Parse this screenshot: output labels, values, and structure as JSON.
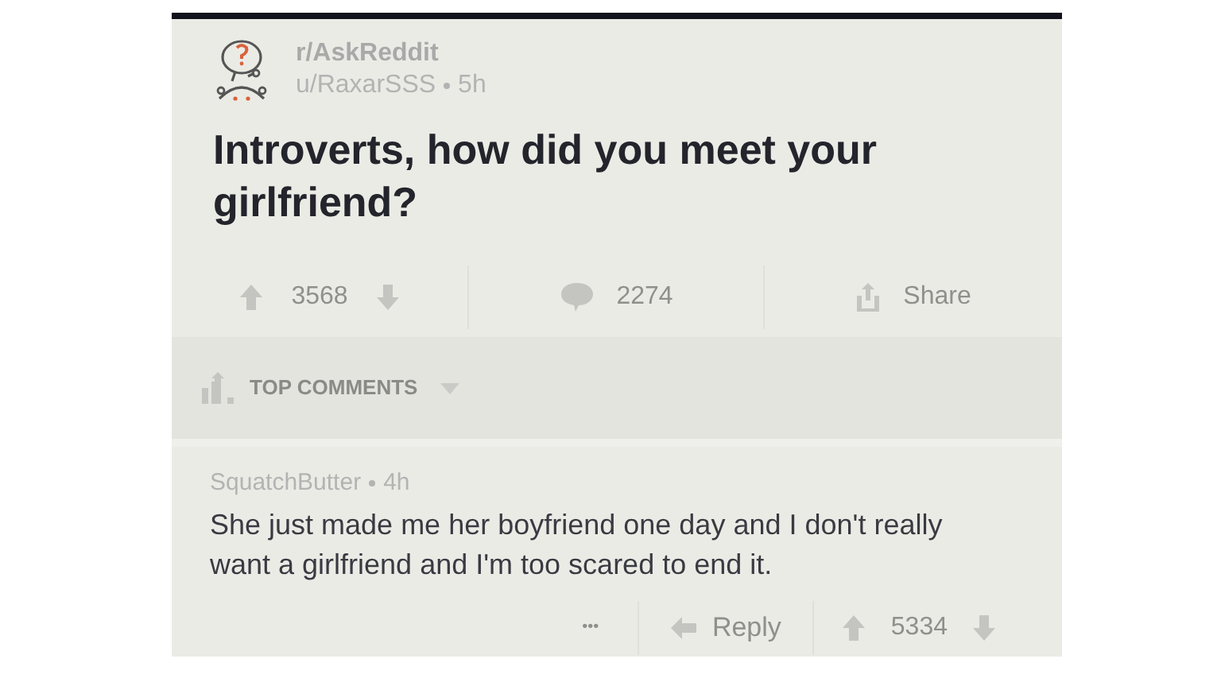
{
  "post": {
    "subreddit": "r/AskReddit",
    "author": "u/RaxarSSS",
    "age": "5h",
    "title": "Introverts, how did you meet your girlfriend?",
    "score": "3568",
    "comments": "2274",
    "share": "Share"
  },
  "sort": {
    "label": "TOP COMMENTS"
  },
  "comments": [
    {
      "author": "SquatchButter",
      "age": "4h",
      "body": "She just made me her boyfriend one day and I don't really want a girlfriend and I'm too scared to end it.",
      "more": "•••",
      "reply": "Reply",
      "score": "5334"
    }
  ]
}
